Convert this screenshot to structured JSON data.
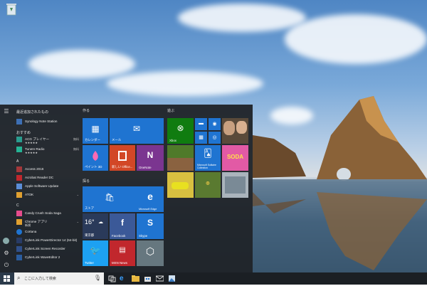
{
  "start": {
    "recent_header": "最近追加されたもの",
    "recent_app": "Synology Note Station",
    "suggested_header": "おすすめ",
    "suggested": [
      {
        "name": "ACG プレイヤー",
        "rating": "★★★★★",
        "tag": "無料"
      },
      {
        "name": "TuneIn Radio",
        "rating": "★★★★★",
        "tag": "無料"
      }
    ],
    "letter_a": "A",
    "a_apps": [
      "Access 2016",
      "Acrobat Reader DC",
      "Apple Software Update",
      "ATOK"
    ],
    "letter_c": "C",
    "c_apps": [
      "Candy Crush Soda Saga",
      "Chrome アプリ",
      "Cortana",
      "CyberLink PowerDirector 14 (64-bit)",
      "CyberLink Screen Recorder",
      "CyberLink WaveEditor 2"
    ],
    "chrome_sub": "新規",
    "groups": {
      "create": "作る",
      "play": "遊ぶ",
      "explore": "探る"
    },
    "tiles": {
      "calendar": "カレンダー",
      "mail": "メール",
      "paint3d": "ペイント 3D",
      "office": "新しい Office...",
      "onenote": "OneNote",
      "xbox": "Xbox",
      "solitaire": "Microsoft Solitaire Collection",
      "candy": "SODA",
      "store": "ストア",
      "edge": "Microsoft Edge",
      "weather_temp": "16°",
      "weather_loc": "東京都",
      "facebook": "Facebook",
      "skype": "Skype",
      "twitter": "Twitter",
      "msn": "MSN News"
    }
  },
  "taskbar": {
    "search_placeholder": "ここに入力して検索"
  },
  "colors": {
    "tile_blue": "#1f74d1",
    "office_orange": "#d24726",
    "onenote_purple": "#7b3590",
    "xbox_green": "#107c10",
    "twitter_blue": "#1da1f2",
    "msn_red": "#c1272d"
  }
}
